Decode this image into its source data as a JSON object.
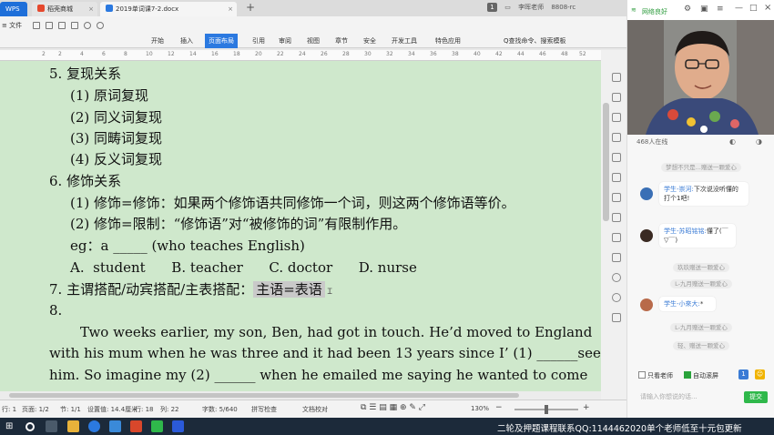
{
  "tabs": [
    {
      "label": "WPS"
    },
    {
      "label": "稻壳商城"
    },
    {
      "label": "2019单词课7-2.docx"
    }
  ],
  "titlebar": {
    "badge": "1",
    "user": "李晖老师",
    "version": "8808-rc"
  },
  "menu": {
    "file": "≡ 文件",
    "items": [
      "开始",
      "插入",
      "页面布局",
      "引用",
      "审阅",
      "视图",
      "章节",
      "安全",
      "开发工具",
      "特色应用"
    ],
    "active_index": 2,
    "search": "Q查找命令、搜索模板"
  },
  "ruler": {
    "labels": [
      "2",
      "2",
      "4",
      "6",
      "8",
      "10",
      "12",
      "14",
      "16",
      "18",
      "20",
      "22",
      "24",
      "26",
      "28",
      "30",
      "32",
      "34",
      "36",
      "38",
      "40",
      "42",
      "44",
      "46",
      "48",
      "52"
    ]
  },
  "document": {
    "lines": [
      "5.  复现关系",
      "(1) 原词复现",
      "(2) 同义词复现",
      "(3) 同畴词复现",
      "(4) 反义词复现",
      "6.  修饰关系",
      "(1) 修饰=修饰：如果两个修饰语共同修饰一个词，则这两个修饰语等价。",
      "(2) 修饰=限制：“修饰语”对“被修饰的词”有限制作用。",
      "eg：a _____ (who teaches English)",
      "A.  student      B. teacher      C. doctor      D. nurse",
      "7.  主谓搭配/动宾搭配/主表搭配：",
      "8.",
      "Two weeks earlier, my son, Ben, had got in touch. He’d moved to England",
      "with his mum when he was three and it had been 13 years since I’ (1) ______seen",
      "him. So imagine my (2) ______ when he emailed me saying he wanted to come"
    ],
    "highlight": "主语=表语"
  },
  "status": {
    "items": [
      "行: 1",
      "页面: 1/2",
      "节: 1/1",
      "设置值: 14.4厘米",
      "行: 18",
      "列: 22",
      "字数: 5/640",
      "拼写检查",
      "文档校对"
    ],
    "zoom": "130%"
  },
  "live": {
    "network": "网络良好",
    "online": "468人在线",
    "messages": [
      {
        "type": "sys",
        "text": "梦想不只是...赠送一颗爱心"
      },
      {
        "type": "msg",
        "name": "学生-崇河:",
        "text": "下次说没听懂的打个1吧!"
      },
      {
        "type": "msg",
        "name": "学生-苏昭铭铭:",
        "text": "懂了(￣▽￣)"
      },
      {
        "type": "sys",
        "text": "玖玖赠送一颗爱心"
      },
      {
        "type": "sys",
        "text": "L-九月赠送一颗爱心"
      },
      {
        "type": "msg",
        "name": "学生-小來大:",
        "text": "*"
      },
      {
        "type": "sys",
        "text": "L-九月赠送一颗爱心"
      },
      {
        "type": "sys",
        "text": "轻、赠送一颗爱心"
      }
    ],
    "only_teacher": "只看老师",
    "auto_scroll": "自动滚屏",
    "input_placeholder": "请输入你想说的话...",
    "send": "提交"
  },
  "taskbar": {
    "promo": "二轮及押题课程联系QQ:1144462020单个老师低至十元包更新"
  }
}
